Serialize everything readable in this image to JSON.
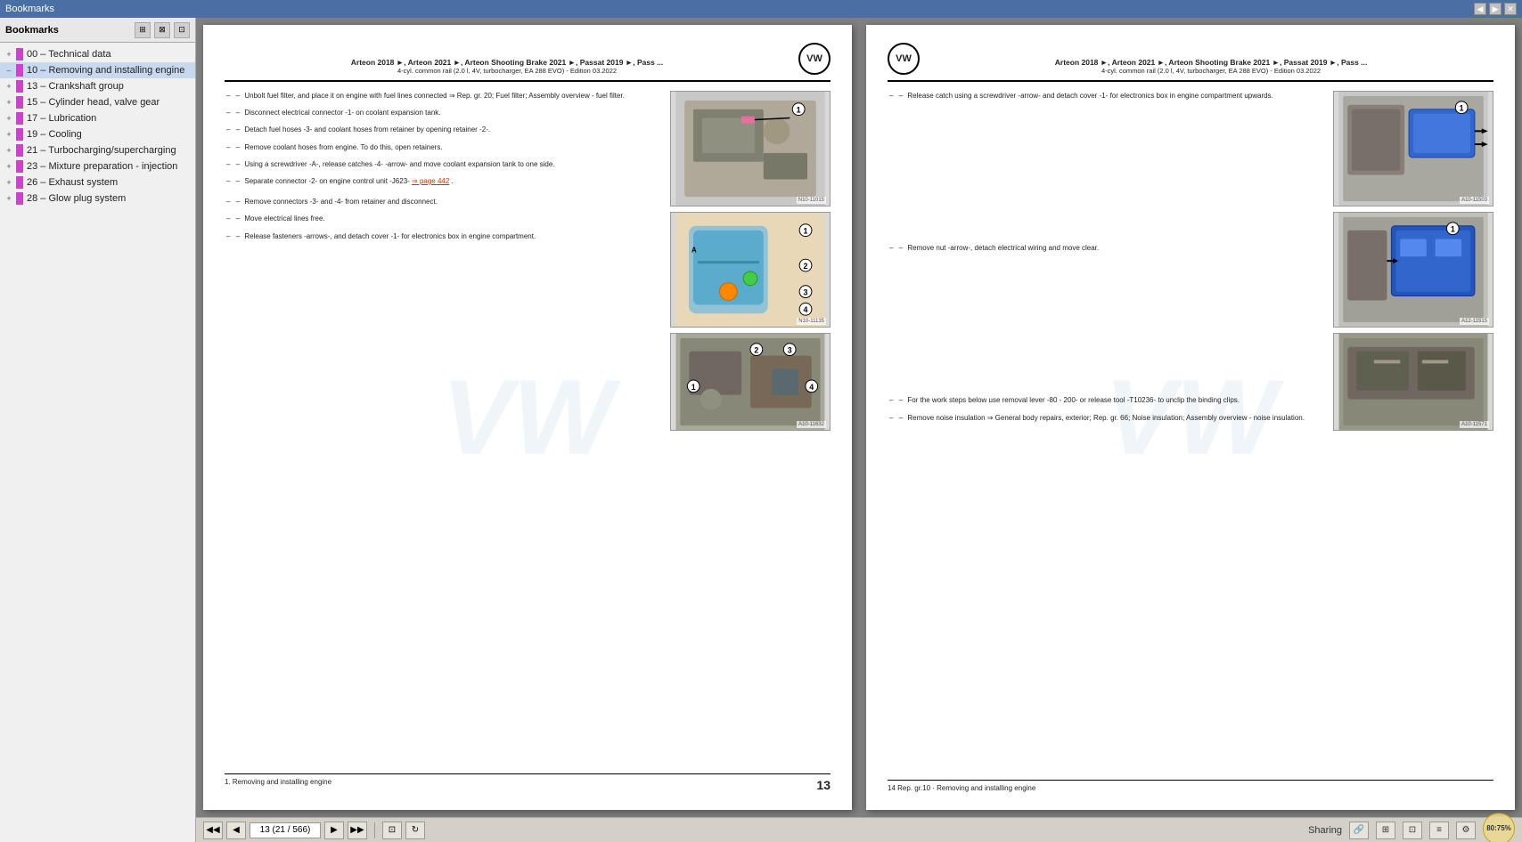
{
  "titlebar": {
    "title": "Bookmarks",
    "buttons": [
      "◀",
      "▶",
      "✕"
    ]
  },
  "sidebar": {
    "toolbar_icons": [
      "⊞",
      "⊠",
      "⊡"
    ],
    "items": [
      {
        "id": "00",
        "label": "00 – Technical data",
        "color": "#cc44cc",
        "expanded": false
      },
      {
        "id": "10",
        "label": "10 – Removing and installing engine",
        "color": "#cc44cc",
        "expanded": true,
        "active": true
      },
      {
        "id": "13",
        "label": "13 – Crankshaft group",
        "color": "#cc44cc",
        "expanded": false
      },
      {
        "id": "15",
        "label": "15 – Cylinder head, valve gear",
        "color": "#cc44cc",
        "expanded": false
      },
      {
        "id": "17",
        "label": "17 – Lubrication",
        "color": "#cc44cc",
        "expanded": false
      },
      {
        "id": "19",
        "label": "19 – Cooling",
        "color": "#cc44cc",
        "expanded": false
      },
      {
        "id": "21",
        "label": "21 – Turbocharging/supercharging",
        "color": "#cc44cc",
        "expanded": false
      },
      {
        "id": "23",
        "label": "23 – Mixture preparation - injection",
        "color": "#cc44cc",
        "expanded": false
      },
      {
        "id": "26",
        "label": "26 – Exhaust system",
        "color": "#cc44cc",
        "expanded": false
      },
      {
        "id": "28",
        "label": "28 – Glow plug system",
        "color": "#cc44cc",
        "expanded": false
      }
    ]
  },
  "left_page": {
    "page_num": "13",
    "header": {
      "title": "Arteon 2018 ►, Arteon 2021 ►, Arteon Shooting Brake 2021 ►, Passat 2019 ►, Pass ...",
      "subtitle": "4-cyl. common rail (2.0 l, 4V, turbocharger, EA 288 EVO) - Edition 03.2022"
    },
    "footer": {
      "left": "1. Removing and installing engine",
      "right": "13"
    },
    "images": [
      {
        "id": "N10-11015",
        "size": "large",
        "label": "N10-11015"
      },
      {
        "id": "N10-11135",
        "size": "medium",
        "label": "N10-11135"
      },
      {
        "id": "A10-11632",
        "size": "small",
        "label": "A10-11632"
      }
    ],
    "instructions": [
      "Unbolt fuel filter, and place it on engine with fuel lines connected ⇒ Rep. gr. 20; Fuel filter; Assembly overview - fuel filter.",
      "Disconnect electrical connector -1- on coolant expansion tank.",
      "Detach fuel hoses -3- and coolant hoses from retainer by opening retainer -2-.",
      "Remove coolant hoses from engine. To do this, open retainers.",
      "Using a screwdriver -A-, release catches -4- -arrow- and move coolant expansion tank to one side.",
      "Separate connector -2- on engine control unit -J623- ⇒ page 442.",
      "Remove connectors -3- and -4- from retainer and disconnect.",
      "Move electrical lines free.",
      "Release fasteners -arrows-, and detach cover -1- for electronics box in engine compartment."
    ],
    "link_text": "⇒ page 442"
  },
  "right_page": {
    "page_num": "14",
    "header": {
      "title": "Arteon 2018 ►, Arteon 2021 ►, Arteon Shooting Brake 2021 ►, Passat 2019 ►, Pass ...",
      "subtitle": "4-cyl. common rail (2.0 l, 4V, turbocharger, EA 288 EVO) - Edition 03.2022"
    },
    "footer": {
      "left": "14  Rep. gr.10 · Removing and installing engine",
      "right": ""
    },
    "images": [
      {
        "id": "A10-11503",
        "size": "large",
        "label": "A10-11503"
      },
      {
        "id": "A12-11515",
        "size": "medium",
        "label": "A12-11515"
      },
      {
        "id": "A10-11571",
        "size": "small",
        "label": "A10-11571"
      }
    ],
    "instructions": [
      "Release catch using a screwdriver -arrow- and detach cover -1- for electronics box in engine compartment upwards.",
      "Remove nut -arrow-, detach electrical wiring and move clear.",
      "For the work steps below use removal lever -80 - 200- or release tool -T10236- to unclip the binding clips.",
      "Remove noise insulation ⇒ General body repairs, exterior; Rep. gr. 66; Noise insulation; Assembly overview - noise insulation."
    ]
  },
  "bottom_toolbar": {
    "prev_first": "◀◀",
    "prev": "◀",
    "page_display": "13 (21 / 566)",
    "next": "▶",
    "next_last": "▶▶",
    "zoom": "80:75%",
    "status_right": "Sharing"
  },
  "colors": {
    "sidebar_bg": "#f0f0f0",
    "toolbar_bg": "#d4d0c8",
    "accent_blue": "#005baa",
    "link_color": "#cc3300"
  }
}
